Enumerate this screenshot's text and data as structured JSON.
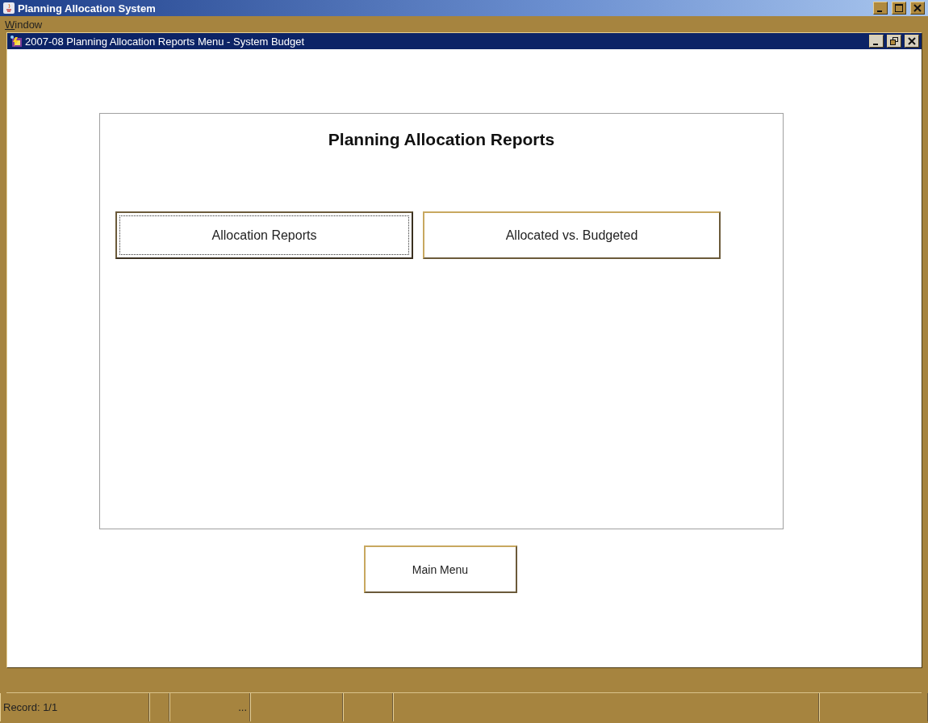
{
  "window": {
    "title": "Planning Allocation System"
  },
  "menu": [
    {
      "label": "Window",
      "first_letter_underlined": true
    }
  ],
  "inner_window": {
    "title": "2007-08 Planning Allocation Reports Menu - System Budget"
  },
  "panel": {
    "heading": "Planning Allocation Reports",
    "buttons": [
      {
        "label": "Allocation Reports",
        "focused": true
      },
      {
        "label": "Allocated vs. Budgeted",
        "focused": false
      }
    ]
  },
  "main_menu_button": {
    "label": "Main Menu"
  },
  "status_bar": {
    "record": "Record: 1/1",
    "cell_3": "..."
  }
}
